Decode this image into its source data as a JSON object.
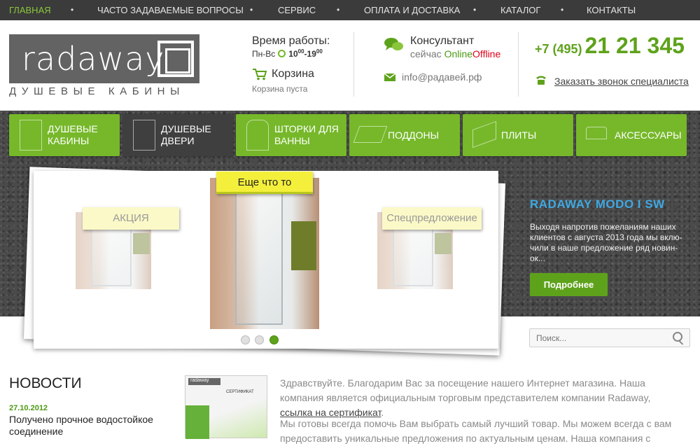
{
  "topnav": {
    "items": [
      {
        "label": "ГЛАВНАЯ",
        "active": true
      },
      {
        "label": "ЧАСТО ЗАДАВАЕМЫЕ ВОПРОСЫ",
        "active": false
      },
      {
        "label": "СЕРВИС",
        "active": false
      },
      {
        "label": "ОПЛАТА И ДОСТАВКА",
        "active": false
      },
      {
        "label": "КАТАЛОГ",
        "active": false
      },
      {
        "label": "КОНТАКТЫ",
        "active": false
      }
    ],
    "separator": "•"
  },
  "header": {
    "logo_text": "radaway",
    "logo_sub": "ДУШЕВЫЕ КАБИНЫ",
    "hours_title": "Время работы:",
    "hours_days": "Пн-Вс",
    "hours_from": "10",
    "hours_from_sup": "00",
    "hours_dash": "-",
    "hours_to": "19",
    "hours_to_sup": "00",
    "cart_title": "Корзина",
    "cart_status": "Корзина пуста",
    "consultant_title": "Консультант",
    "consultant_prefix": "сейчас",
    "consultant_online": "Online",
    "consultant_offline": "Offline",
    "email": "info@радавей.рф",
    "phone_code": "+7 (495)",
    "phone_number": "21 21 345",
    "callback_label": "Заказать звонок специалиста"
  },
  "categories": [
    {
      "label": "ДУШЕВЫЕ КАБИНЫ",
      "icon": "shower-cabin-icon",
      "active": false
    },
    {
      "label": "ДУШЕВЫЕ ДВЕРИ",
      "icon": "shower-door-icon",
      "active": true
    },
    {
      "label": "ШТОРКИ ДЛЯ ВАННЫ",
      "icon": "bath-screen-icon",
      "active": false
    },
    {
      "label": "ПОДДОНЫ",
      "icon": "shower-tray-icon",
      "active": false
    },
    {
      "label": "ПЛИТЫ",
      "icon": "panel-icon",
      "active": false
    },
    {
      "label": "АКСЕССУАРЫ",
      "icon": "faucet-icon",
      "active": false
    }
  ],
  "slider": {
    "left_sticker": "АКЦИЯ",
    "center_sticker": "Еще что то",
    "right_sticker": "Спецпредложение",
    "pages": 3,
    "active_page": 3
  },
  "promo": {
    "title": "RADAWAY MODO I SW",
    "text": "Выходя напротив пожеланиям наших клиентов с августа 2013 года мы вклю-чили в наше предложение ряд новин-ок...",
    "button": "Подробнее"
  },
  "search": {
    "placeholder": "Поиск..."
  },
  "news": {
    "heading": "НОВОСТИ",
    "date": "27.10.2012",
    "item": "Получено прочное водостойкое соединение"
  },
  "certificate": {
    "logo": "radaway",
    "label": "СЕРТИФИКАТ"
  },
  "welcome": {
    "text1": "Здравствуйте. Благодарим Вас за посещение нашего Интернет магазина. Наша компания является официальным торговым представителем компании Radaway,",
    "link": "ссылка на сертификат",
    "text1_end": ".",
    "text2": "Мы готовы всегда помочь Вам выбрать самый лучший товар. Мы можем всегда с вам предоставить уникальные предложения по актуальным ценам. Наша компания с"
  },
  "colors": {
    "accent": "#76b82a",
    "dark": "#3b3b3b",
    "link_blue": "#3fa9e3",
    "offline_red": "#e0001b"
  }
}
